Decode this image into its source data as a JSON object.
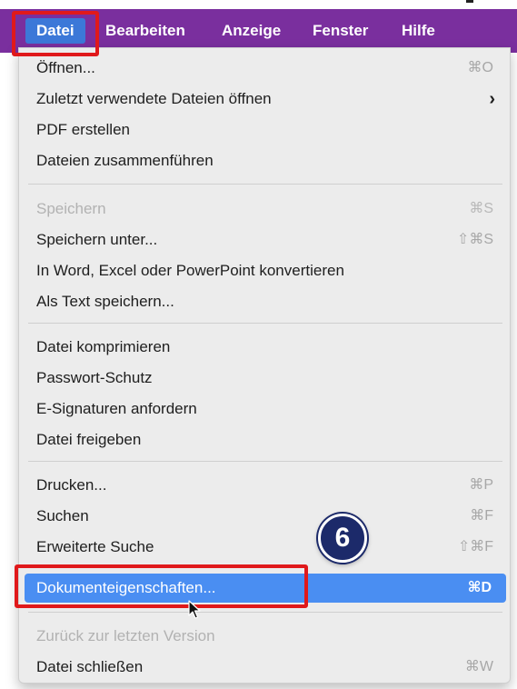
{
  "menubar": {
    "items": [
      {
        "label": "Datei"
      },
      {
        "label": "Bearbeiten"
      },
      {
        "label": "Anzeige"
      },
      {
        "label": "Fenster"
      },
      {
        "label": "Hilfe"
      }
    ]
  },
  "menu": {
    "items": [
      {
        "label": "Öffnen...",
        "shortcut": "⌘O"
      },
      {
        "label": "Zuletzt verwendete Dateien öffnen",
        "submenu_indicator": "›"
      },
      {
        "label": "PDF erstellen"
      },
      {
        "label": "Dateien zusammenführen"
      },
      {
        "label": "Speichern",
        "shortcut": "⌘S",
        "disabled": true
      },
      {
        "label": "Speichern unter...",
        "shortcut": "⇧⌘S"
      },
      {
        "label": "In Word, Excel oder PowerPoint konvertieren"
      },
      {
        "label": "Als Text speichern..."
      },
      {
        "label": "Datei komprimieren"
      },
      {
        "label": "Passwort-Schutz"
      },
      {
        "label": "E-Signaturen anfordern"
      },
      {
        "label": "Datei freigeben"
      },
      {
        "label": "Drucken...",
        "shortcut": "⌘P"
      },
      {
        "label": "Suchen",
        "shortcut": "⌘F"
      },
      {
        "label": "Erweiterte Suche",
        "shortcut": "⇧⌘F"
      },
      {
        "label": "Dokumenteigenschaften...",
        "shortcut": "⌘D",
        "selected": true
      },
      {
        "label": "Zurück zur letzten Version",
        "disabled": true
      },
      {
        "label": "Datei schließen",
        "shortcut": "⌘W"
      }
    ]
  },
  "annotation": {
    "step_number": "6"
  },
  "colors": {
    "menubar_bg": "#7a2f9e",
    "active_menu_bg": "#3c78d8",
    "selection_bg": "#4a8ef2",
    "highlight_border": "#e0191b",
    "step_badge_bg": "#1c2a6a"
  }
}
